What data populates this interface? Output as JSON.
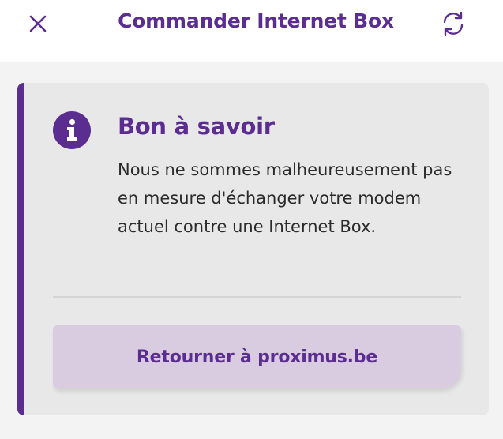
{
  "header": {
    "title": "Commander Internet Box",
    "close_icon": "close-icon",
    "refresh_icon": "refresh-icon"
  },
  "notice": {
    "icon": "info-icon",
    "title": "Bon à savoir",
    "body": "Nous ne sommes malheureusement pas en mesure d'échanger votre modem actuel contre une Internet Box.",
    "button_label": "Retourner à proximus.be"
  },
  "colors": {
    "brand": "#5c2d91",
    "card_background": "#e8e8e8",
    "button_background": "#d9cce0"
  }
}
